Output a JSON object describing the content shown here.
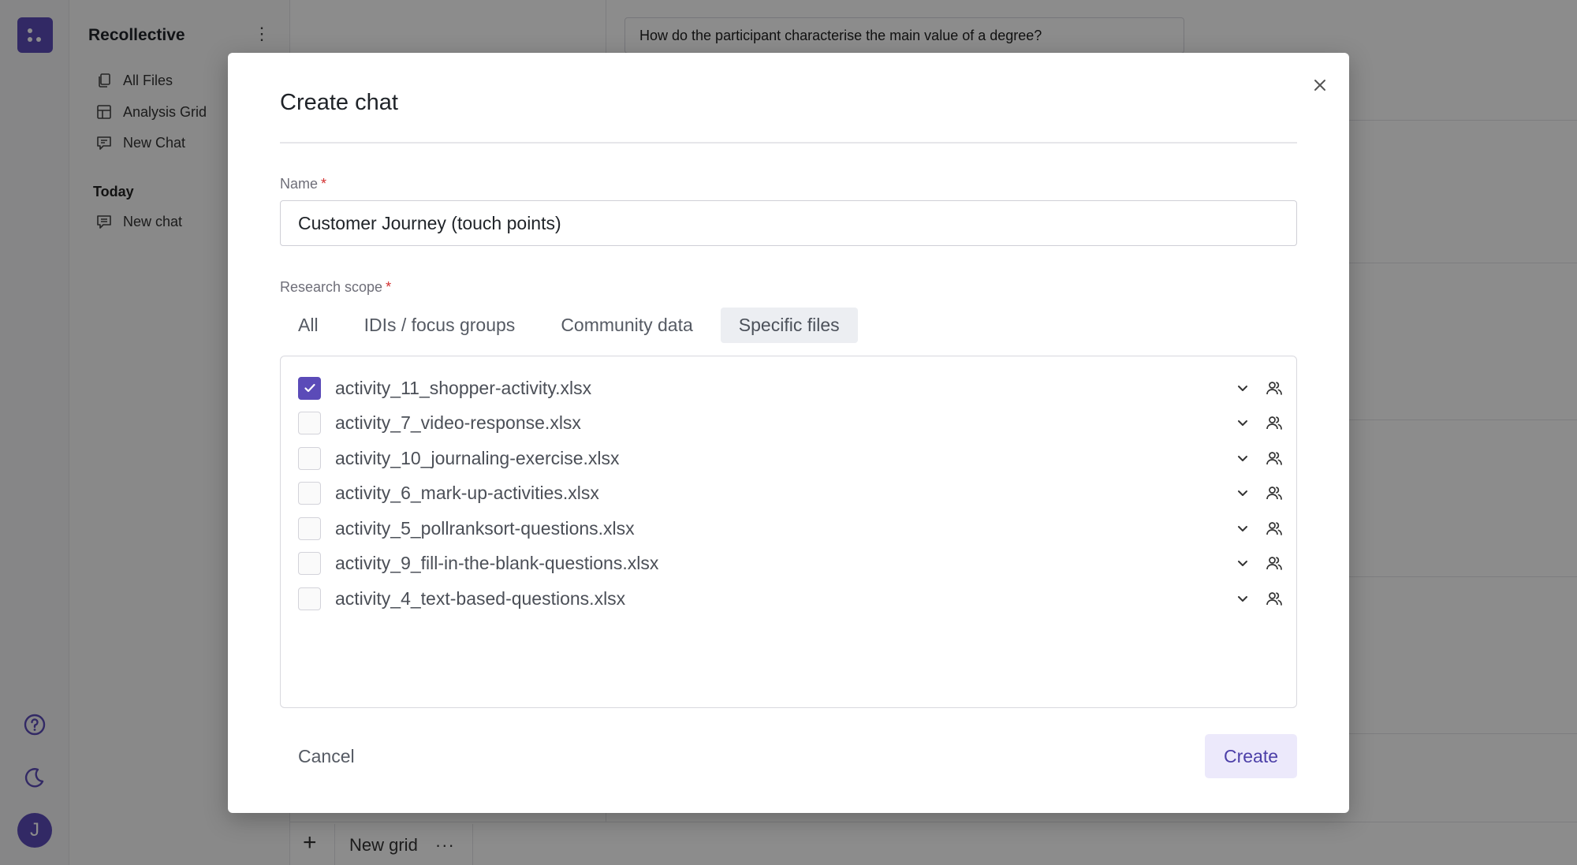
{
  "app": {
    "name": "Recollective",
    "avatar_initial": "J",
    "nav": [
      {
        "label": "All Files",
        "icon": "files-icon"
      },
      {
        "label": "Analysis Grid",
        "icon": "grid-icon"
      },
      {
        "label": "New Chat",
        "icon": "new-chat-icon"
      }
    ],
    "section_today": "Today",
    "chats": [
      {
        "label": "New chat",
        "icon": "chat-icon"
      }
    ],
    "background_question": "How do the participant characterise the main value of a degree?",
    "bottom_tab": "New grid",
    "bottom_more": "···",
    "bottom_add": "+"
  },
  "modal": {
    "title": "Create chat",
    "name_label": "Name",
    "required_marker": "*",
    "name_value": "Customer Journey (touch points)",
    "scope_label": "Research scope",
    "tabs": [
      {
        "label": "All",
        "active": false
      },
      {
        "label": "IDIs / focus groups",
        "active": false
      },
      {
        "label": "Community data",
        "active": false
      },
      {
        "label": "Specific files",
        "active": true
      }
    ],
    "files": [
      {
        "name": "activity_11_shopper-activity.xlsx",
        "checked": true
      },
      {
        "name": "activity_7_video-response.xlsx",
        "checked": false
      },
      {
        "name": "activity_10_journaling-exercise.xlsx",
        "checked": false
      },
      {
        "name": "activity_6_mark-up-activities.xlsx",
        "checked": false
      },
      {
        "name": "activity_5_pollranksort-questions.xlsx",
        "checked": false
      },
      {
        "name": "activity_9_fill-in-the-blank-questions.xlsx",
        "checked": false
      },
      {
        "name": "activity_4_text-based-questions.xlsx",
        "checked": false
      }
    ],
    "cancel_label": "Cancel",
    "create_label": "Create"
  },
  "colors": {
    "accent": "#5b4bb8",
    "create_bg": "#ece9fb",
    "required": "#d32f2f"
  }
}
